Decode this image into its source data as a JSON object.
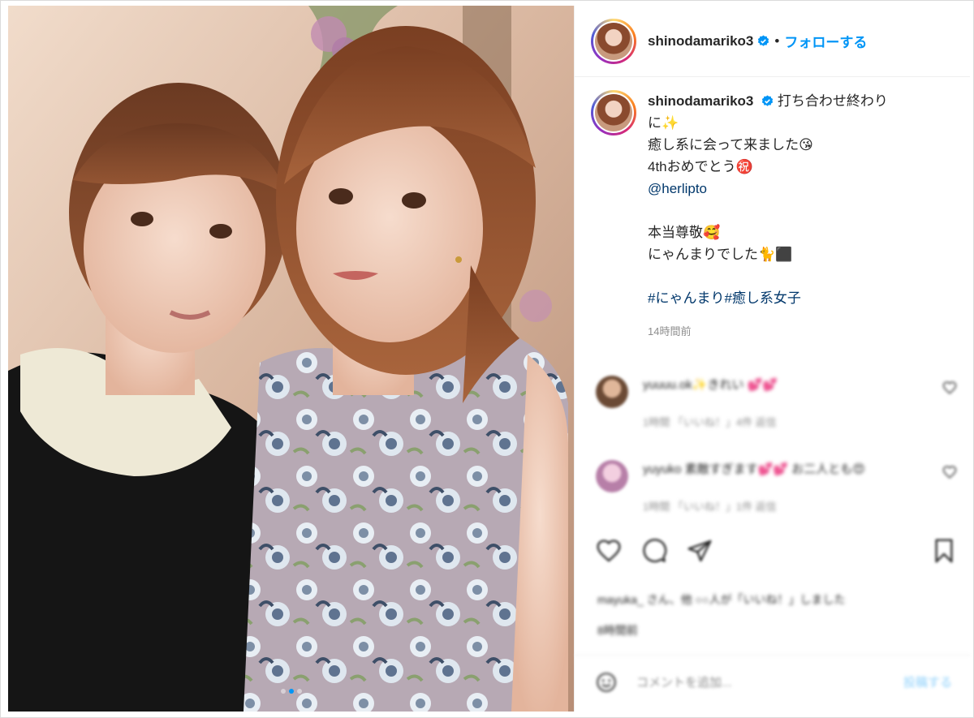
{
  "post": {
    "username": "shinodamariko3",
    "verified": true,
    "header_separator": "•",
    "follow_label": "フォローする",
    "caption_lines": [
      "打ち合わせ終わり",
      "に✨",
      "癒し系に会って来ました😘",
      "4thおめでとう㊗️"
    ],
    "mention": "@herlipto",
    "caption_lines_2": [
      "本当尊敬🥰",
      "にゃんまりでした🐈⬛"
    ],
    "hashtags": "#にゃんまり#癒し系女子",
    "time": "14時間前"
  },
  "comments": [
    {
      "author": "yuuuu.ok",
      "text": "yuuuu.ok✨きれい 💕💕",
      "meta": "1時間 「いいね！」4件 返信"
    },
    {
      "author": "yuyuko",
      "text": "yuyuko 素敵すぎます💕💕 お二人とも😍",
      "meta": "1時間 「いいね！」1件 返信"
    }
  ],
  "likes": {
    "text": "mayuka_ さん、他 ○○人が「いいね！」しました",
    "count": "8時間前"
  },
  "add_comment": {
    "placeholder": "コメントを追加...",
    "post_label": "投稿する"
  },
  "icons": [
    "verified-badge-icon",
    "heart-icon",
    "comment-icon",
    "share-icon",
    "bookmark-icon",
    "emoji-icon"
  ],
  "colors": {
    "accent": "#0095f6",
    "link": "#00376b",
    "muted": "#8e8e8e",
    "border": "#efefef"
  },
  "carousel": {
    "count": 3,
    "active": 1
  }
}
